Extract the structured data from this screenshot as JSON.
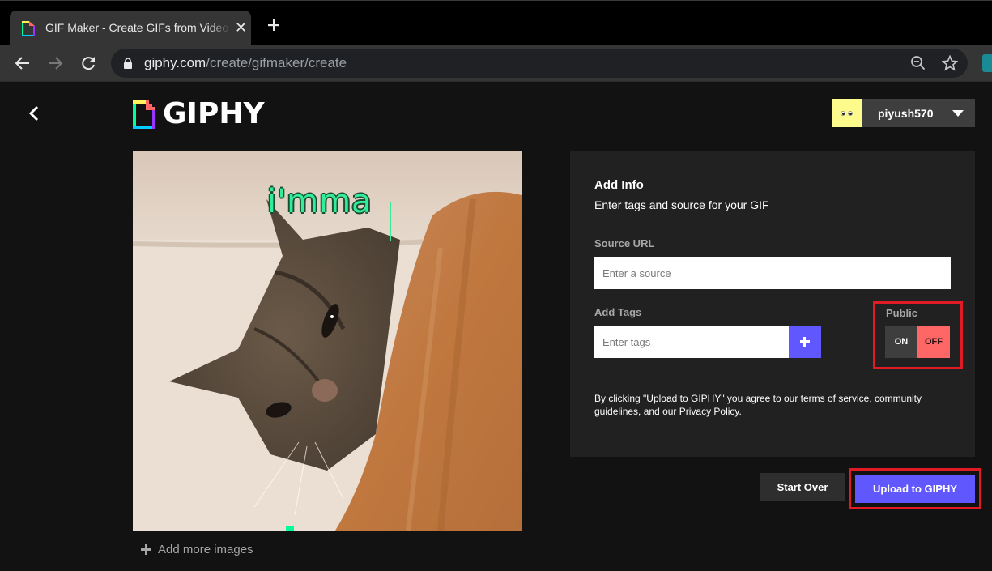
{
  "browser": {
    "tab_title": "GIF Maker - Create GIFs from Videos, Images",
    "tab_close_icon": "close-icon",
    "new_tab_icon": "plus-icon",
    "url_host": "giphy.com",
    "url_path": "/create/gifmaker/create",
    "toolbar_icons": [
      "back-icon",
      "forward-icon",
      "reload-icon",
      "lock-icon",
      "zoom-out-icon",
      "star-icon",
      "extension-icon"
    ]
  },
  "header": {
    "logo_text": "GIPHY",
    "user": {
      "name": "piyush570",
      "menu_icon": "caret-down-icon"
    }
  },
  "preview": {
    "caption_text": "i'mma",
    "add_more_label": "Add more images"
  },
  "info_panel": {
    "title": "Add Info",
    "subtitle": "Enter tags and source for your GIF",
    "source_url": {
      "label": "Source URL",
      "placeholder": "Enter a source",
      "value": ""
    },
    "tags": {
      "label": "Add Tags",
      "placeholder": "Enter tags",
      "value": "",
      "add_icon": "plus-icon"
    },
    "public": {
      "label": "Public",
      "on_label": "ON",
      "off_label": "OFF",
      "selected": "OFF"
    },
    "terms_text": "By clicking \"Upload to GIPHY\" you agree to our terms of service, community guidelines, and our Privacy Policy."
  },
  "actions": {
    "start_over_label": "Start Over",
    "upload_label": "Upload to GIPHY"
  },
  "colors": {
    "accent_purple": "#6157ff",
    "off_red": "#ff6666",
    "highlight_red": "#e01b24",
    "caption_green": "#33ee99",
    "page_bg": "#121212",
    "panel_bg": "#212121"
  }
}
